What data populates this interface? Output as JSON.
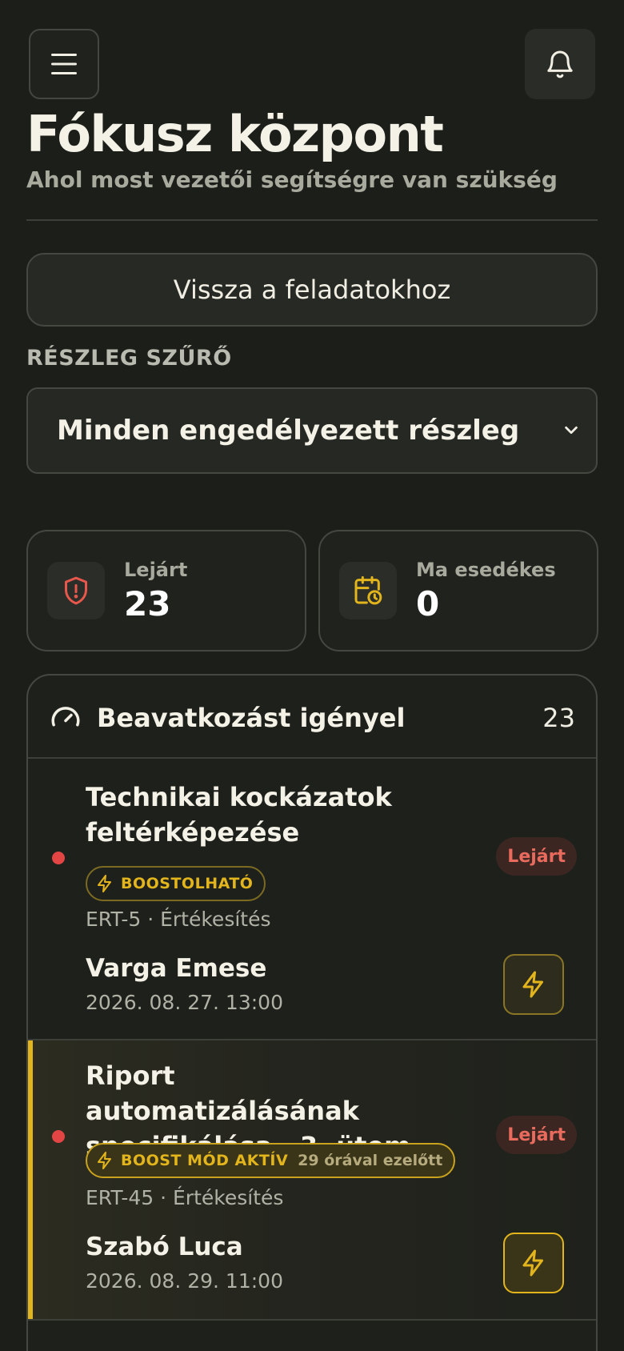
{
  "header": {
    "title": "Fókusz központ",
    "subtitle": "Ahol most vezetői segítségre van szükség"
  },
  "actions": {
    "back_label": "Vissza a feladatokhoz"
  },
  "filter": {
    "label": "RÉSZLEG SZŰRŐ",
    "selected": "Minden engedélyezett részleg"
  },
  "stats": [
    {
      "label": "Lejárt",
      "value": "23",
      "icon": "shield-alert-icon",
      "color": "#e8574c"
    },
    {
      "label": "Ma esedékes",
      "value": "0",
      "icon": "calendar-clock-icon",
      "color": "#e3b51c"
    }
  ],
  "panel": {
    "title": "Beavatkozást igényel",
    "count": "23",
    "tasks": [
      {
        "title_line1": "Technikai kockázatok",
        "title_line2": "feltérképezése",
        "status": "Lejárt",
        "pill": "BOOSTOLHATÓ",
        "pill_ago": "",
        "meta": "ERT-5 · Értékesítés",
        "person": "Varga Emese",
        "date": "2026. 08. 27. 13:00"
      },
      {
        "title_line1": "Riport automatizálásának",
        "title_line2": "specifikálása · 3. ütem",
        "status": "Lejárt",
        "pill": "BOOST MÓD AKTÍV",
        "pill_ago": "29 órával ezelőtt",
        "meta": "ERT-45 · Értékesítés",
        "person": "Szabó Luca",
        "date": "2026. 08. 29. 11:00"
      }
    ]
  },
  "colors": {
    "accent": "#e3b51c",
    "danger": "#e34545",
    "background": "#1c1e1a"
  }
}
